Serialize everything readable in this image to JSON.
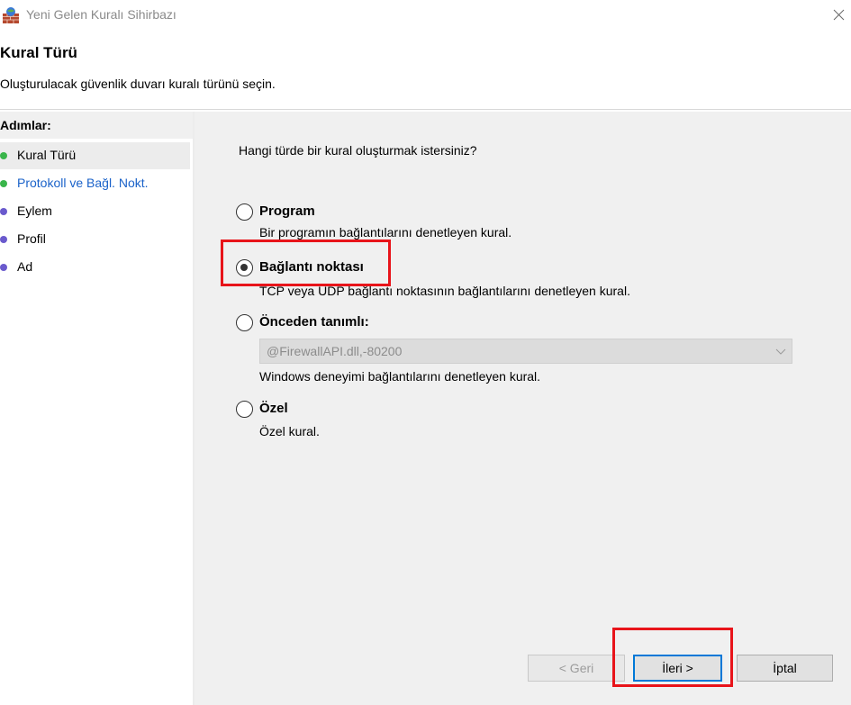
{
  "window": {
    "title": "Yeni Gelen Kuralı Sihirbazı",
    "icon": "firewall-wall-icon",
    "close_icon": "close-icon"
  },
  "header": {
    "title": "Kural Türü",
    "description": "Oluşturulacak güvenlik duvarı kuralı türünü seçin."
  },
  "steps": {
    "title": "Adımlar:",
    "items": [
      {
        "label": "Kural Türü",
        "color": "#39b54a"
      },
      {
        "label": "Protokoll ve Bağl. Nokt.",
        "color": "#39b54a"
      },
      {
        "label": "Eylem",
        "color": "#6a5acd"
      },
      {
        "label": "Profil",
        "color": "#6a5acd"
      },
      {
        "label": "Ad",
        "color": "#6a5acd"
      }
    ]
  },
  "main": {
    "question": "Hangi türde bir kural oluşturmak istersiniz?",
    "options": [
      {
        "label": "Program",
        "description": "Bir programın bağlantılarını denetleyen kural.",
        "checked": false
      },
      {
        "label": "Bağlantı noktası",
        "description": "TCP veya UDP bağlantı noktasının bağlantılarını denetleyen kural.",
        "checked": true
      },
      {
        "label": "Önceden tanımlı:",
        "description": "Windows deneyimi bağlantılarını denetleyen kural.",
        "checked": false
      },
      {
        "label": "Özel",
        "description": "Özel kural.",
        "checked": false
      }
    ],
    "predefined_select": {
      "value": "@FirewallAPI.dll,-80200"
    }
  },
  "buttons": {
    "back": "< Geri",
    "next": "İleri >",
    "cancel": "İptal"
  },
  "colors": {
    "accent": "#0078d7",
    "highlight": "#e8141a"
  }
}
